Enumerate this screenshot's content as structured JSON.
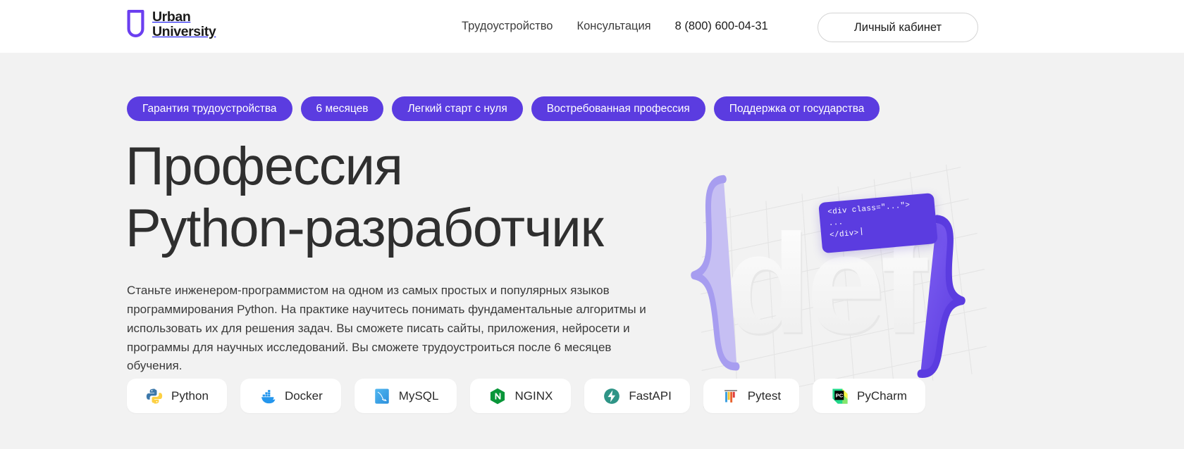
{
  "header": {
    "logo": {
      "line1": "Urban",
      "line2": "University",
      "mark": "u-shield-icon",
      "mark_color": "#6b3ff0"
    },
    "nav_links": [
      {
        "label": "Трудоустройство",
        "name": "nav-link-employment"
      },
      {
        "label": "Консультация",
        "name": "nav-link-consultation"
      }
    ],
    "phone": "8 (800) 600-04-31",
    "account_button": "Личный кабинет"
  },
  "hero": {
    "badges": [
      "Гарантия трудоустройства",
      "6 месяцев",
      "Легкий старт с нуля",
      "Востребованная профессия",
      "Поддержка от государства"
    ],
    "title_line1": "Профессия",
    "title_line2": "Python-разработчик",
    "description": "Станьте инженером-программистом на одном из самых простых и популярных языков программирования Python. На практике научитесь понимать фундаментальные алгоритмы и использовать их для решения задач. Вы сможете писать сайты, приложения, нейросети и программы для научных исследований. Вы сможете трудоустроиться после 6 месяцев обучения.",
    "illustration": {
      "brace_open": "{",
      "brace_close": "}",
      "word": "def",
      "code_card": {
        "line1": "<div class=\"...\">",
        "line2": "...",
        "line3": "</div>"
      }
    }
  },
  "tech_stack": [
    {
      "label": "Python",
      "icon": "python-icon"
    },
    {
      "label": "Docker",
      "icon": "docker-icon"
    },
    {
      "label": "MySQL",
      "icon": "mysql-icon"
    },
    {
      "label": "NGINX",
      "icon": "nginx-icon"
    },
    {
      "label": "FastAPI",
      "icon": "fastapi-icon"
    },
    {
      "label": "Pytest",
      "icon": "pytest-icon"
    },
    {
      "label": "PyCharm",
      "icon": "pycharm-icon"
    }
  ],
  "colors": {
    "accent_purple": "#5b3ce0",
    "logo_purple": "#6b3ff0",
    "brace_light": "#b6aef0",
    "page_background": "#f2f2f2",
    "header_background": "#ffffff",
    "text_dark": "#2f2f2f"
  }
}
